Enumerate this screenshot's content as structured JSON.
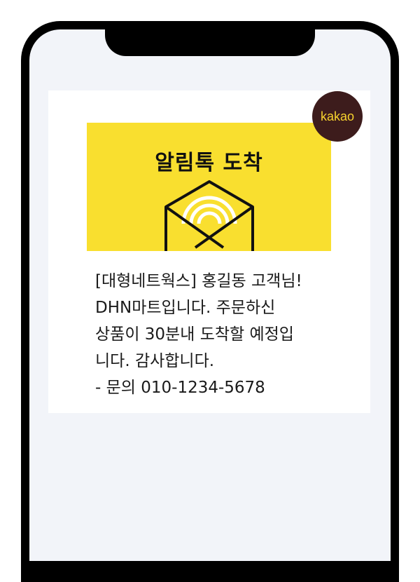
{
  "kakao_badge": {
    "label": "kakao",
    "background": "#3d1c1c",
    "text_color": "#f7d32e"
  },
  "banner": {
    "title": "알림톡 도착",
    "background": "#f9df2f",
    "icon": "envelope-signal-icon"
  },
  "message": {
    "lines": [
      "[대형네트웍스] 홍길동 고객님!",
      "DHN마트입니다. 주문하신",
      "상품이 30분내 도착할 예정입",
      "니다. 감사합니다.",
      "- 문의 010-1234-5678"
    ]
  }
}
